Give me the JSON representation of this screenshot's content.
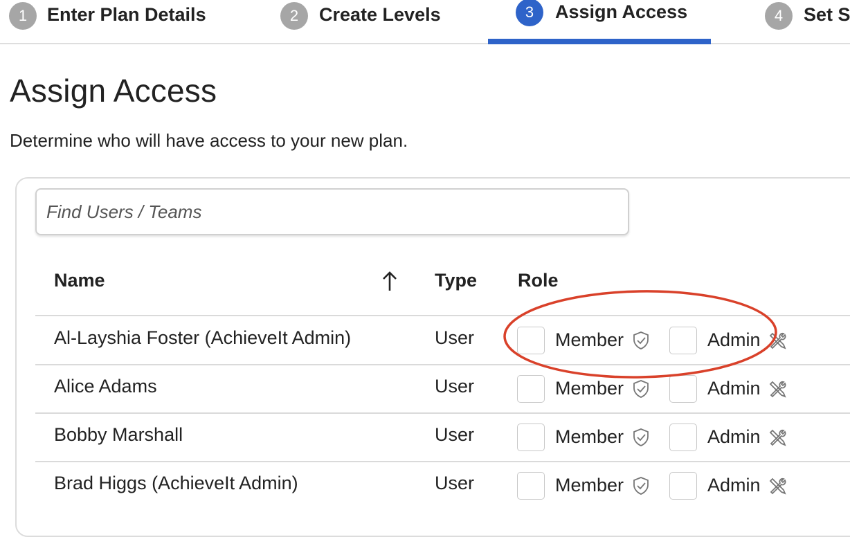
{
  "stepper": {
    "steps": [
      {
        "number": "1",
        "label": "Enter Plan Details"
      },
      {
        "number": "2",
        "label": "Create Levels"
      },
      {
        "number": "3",
        "label": "Assign Access"
      },
      {
        "number": "4",
        "label": "Set Se"
      }
    ],
    "active_step": "3"
  },
  "page": {
    "title": "Assign Access",
    "subtitle": "Determine who will have access to your new plan."
  },
  "search": {
    "placeholder": "Find Users / Teams",
    "value": ""
  },
  "table": {
    "columns": {
      "name": "Name",
      "type": "Type",
      "role": "Role"
    },
    "sort": {
      "column": "Name",
      "direction": "ascending",
      "icon": "arrow-up-icon"
    },
    "role_options": {
      "member": "Member",
      "admin": "Admin",
      "member_icon": "shield-check-icon",
      "admin_icon": "tools-icon"
    },
    "rows": [
      {
        "name": "Al-Layshia Foster (AchieveIt Admin)",
        "type": "User",
        "member_checked": false,
        "admin_checked": false
      },
      {
        "name": "Alice Adams",
        "type": "User",
        "member_checked": false,
        "admin_checked": false
      },
      {
        "name": "Bobby Marshall",
        "type": "User",
        "member_checked": false,
        "admin_checked": false
      },
      {
        "name": "Brad Higgs (AchieveIt Admin)",
        "type": "User",
        "member_checked": false,
        "admin_checked": false
      }
    ]
  },
  "colors": {
    "accent": "#2e63c9",
    "annotation": "#d9412a",
    "inactive_step": "#a6a6a6"
  }
}
